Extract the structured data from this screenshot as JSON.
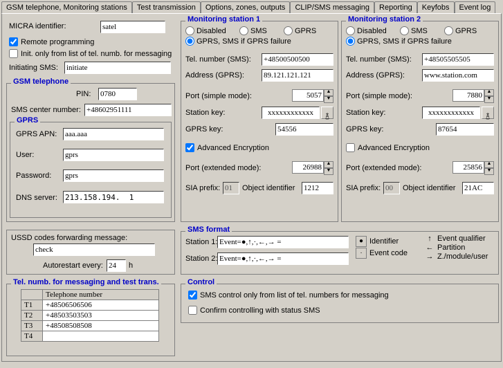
{
  "tabs": [
    "GSM telephone, Monitoring stations",
    "Test transmission",
    "Options, zones, outputs",
    "CLIP/SMS messaging",
    "Reporting",
    "Keyfobs",
    "Event log"
  ],
  "left": {
    "micra_label": "MICRA identifier:",
    "micra_value": "satel",
    "remote_prog": "Remote programming",
    "init_only": "Init. only from list of tel. numb. for messaging",
    "init_sms_label": "Initiating SMS:",
    "init_sms_value": "initiate"
  },
  "gsm": {
    "title": "GSM telephone",
    "pin_label": "PIN:",
    "pin_value": "0780",
    "smsc_label": "SMS center number:",
    "smsc_value": "+48602951111",
    "gprs_title": "GPRS",
    "apn_label": "GPRS APN:",
    "apn_value": "aaa.aaa",
    "user_label": "User:",
    "user_value": "gprs",
    "pass_label": "Password:",
    "pass_value": "gprs",
    "dns_label": "DNS server:",
    "dns_value": "213.158.194.  1"
  },
  "ussd": {
    "label": "USSD codes forwarding message:",
    "value": "check",
    "autorestart_label1": "Autorestart every:",
    "autorestart_value": "24",
    "autorestart_label2": "h"
  },
  "telnum": {
    "title": "Tel. numb. for messaging and test trans.",
    "header": "Telephone number",
    "rows": [
      {
        "id": "T1",
        "num": "+48506506506"
      },
      {
        "id": "T2",
        "num": "+48503503503"
      },
      {
        "id": "T3",
        "num": "+48508508508"
      },
      {
        "id": "T4",
        "num": ""
      }
    ]
  },
  "ms1": {
    "title": "Monitoring station 1",
    "disabled": "Disabled",
    "sms": "SMS",
    "gprs": "GPRS",
    "gprs_sms": "GPRS, SMS if GPRS failure",
    "tel_label": "Tel. number (SMS):",
    "tel_value": "+48500500500",
    "addr_label": "Address (GPRS):",
    "addr_value": "89.121.121.121",
    "port_label": "Port (simple mode):",
    "port_value": "5057",
    "skey_label": "Station key:",
    "skey_value": "xxxxxxxxxxxx",
    "gkey_label": "GPRS key:",
    "gkey_value": "54556",
    "adv_enc": "Advanced Encryption",
    "eport_label": "Port (extended mode):",
    "eport_value": "26988",
    "sia_label": "SIA prefix:",
    "sia_value": "01",
    "obj_label": "Object identifier",
    "obj_value": "1212"
  },
  "ms2": {
    "title": "Monitoring station 2",
    "tel_value": "+48505505505",
    "addr_value": "www.station.com",
    "port_value": "7880",
    "skey_value": "xxxxxxxxxxxx",
    "gkey_value": "87654",
    "eport_value": "25856",
    "sia_value": "00",
    "obj_value": "21AC"
  },
  "smsfmt": {
    "title": "SMS format",
    "s1_label": "Station 1:",
    "s1_value": "Event=●,↑,·,←,→ =",
    "s2_label": "Station 2:",
    "s2_value": "Event=●,↑,·,←,→ =",
    "ident": "Identifier",
    "eventcode": "Event code",
    "evq": "Event qualifier",
    "part": "Partition",
    "zmu": "Z./module/user"
  },
  "control": {
    "title": "Control",
    "only": "SMS control only from list of tel. numbers for messaging",
    "confirm": "Confirm controlling with status SMS"
  },
  "glyph": {
    "eye": "࿄"
  }
}
